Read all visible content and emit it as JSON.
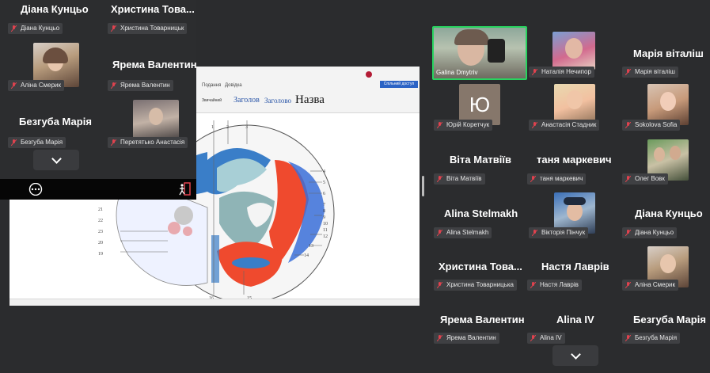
{
  "overlay_panel": {
    "tiles": [
      {
        "name": "Діана Кунцьо",
        "label": "Діана Кунцьо",
        "video": false
      },
      {
        "name": "Христина  Това...",
        "label": "Христина Товарницьк",
        "video": false
      },
      {
        "name": "",
        "label": "Аліна Смерик",
        "video": true
      },
      {
        "name": "Ярема Валентин",
        "label": "Ярема Валентин",
        "video": false
      },
      {
        "name": "Безгуба Марія",
        "label": "Безгуба Марія",
        "video": false
      },
      {
        "name": "",
        "label": "Перетятько Анастасія",
        "video": true
      }
    ],
    "more_icon": "more-horizontal-icon",
    "leave_icon": "leave-icon"
  },
  "document": {
    "menu_tabs": [
      "Подання",
      "Довідка"
    ],
    "styles": [
      "Звичайний",
      "Заголов",
      "Заголово",
      "Назва"
    ],
    "share_label": "Спільний доступ",
    "diagram_labels_right": [
      "4",
      "5",
      "6",
      "7",
      "8",
      "9",
      "10",
      "11",
      "12",
      "13",
      "14"
    ],
    "diagram_labels_left": [
      "21",
      "22",
      "23",
      "20",
      "19"
    ],
    "diagram_labels_bottom": [
      "16",
      "15"
    ],
    "diagram_labels_top": [
      "1",
      "2",
      "3"
    ]
  },
  "gallery": {
    "tiles": [
      {
        "name": "",
        "label": "Galina Dmytriv",
        "video": true,
        "active": true
      },
      {
        "name": "",
        "label": "Наталія Нечипор",
        "video": true
      },
      {
        "name": "Марія віталіш",
        "label": "Марія віталіш",
        "video": false
      },
      {
        "name": "",
        "label": "Юрій Коретчук",
        "avatar_letter": "Ю",
        "video": false
      },
      {
        "name": "",
        "label": "Анастасія Стадник",
        "video": true
      },
      {
        "name": "",
        "label": "Sokolova Sofia",
        "video": true
      },
      {
        "name": "Віта Матвіїв",
        "label": "Віта Матвіїв",
        "video": false
      },
      {
        "name": "таня маркевич",
        "label": "таня маркевич",
        "video": false
      },
      {
        "name": "",
        "label": "Олег Вовк",
        "video": true
      },
      {
        "name": "Alina Stelmakh",
        "label": "Alina Stelmakh",
        "video": false
      },
      {
        "name": "",
        "label": "Вікторія Пінчук",
        "video": true
      },
      {
        "name": "Діана Кунцьо",
        "label": "Діана Кунцьо",
        "video": false
      },
      {
        "name": "Христина  Това...",
        "label": "Христина Товарницька",
        "video": false
      },
      {
        "name": "Настя Лаврів",
        "label": "Настя Лаврів",
        "video": false
      },
      {
        "name": "",
        "label": "Аліна Смерик",
        "video": true
      },
      {
        "name": "Ярема Валентин",
        "label": "Ярема Валентин",
        "video": false
      },
      {
        "name": "Alina IV",
        "label": "Alina IV",
        "video": false
      },
      {
        "name": "Безгуба Марія",
        "label": "Безгуба Марія",
        "video": false
      }
    ]
  },
  "colors": {
    "accent_active": "#28d35f",
    "mic_muted": "#e0424e",
    "background": "#2b2c2e"
  }
}
